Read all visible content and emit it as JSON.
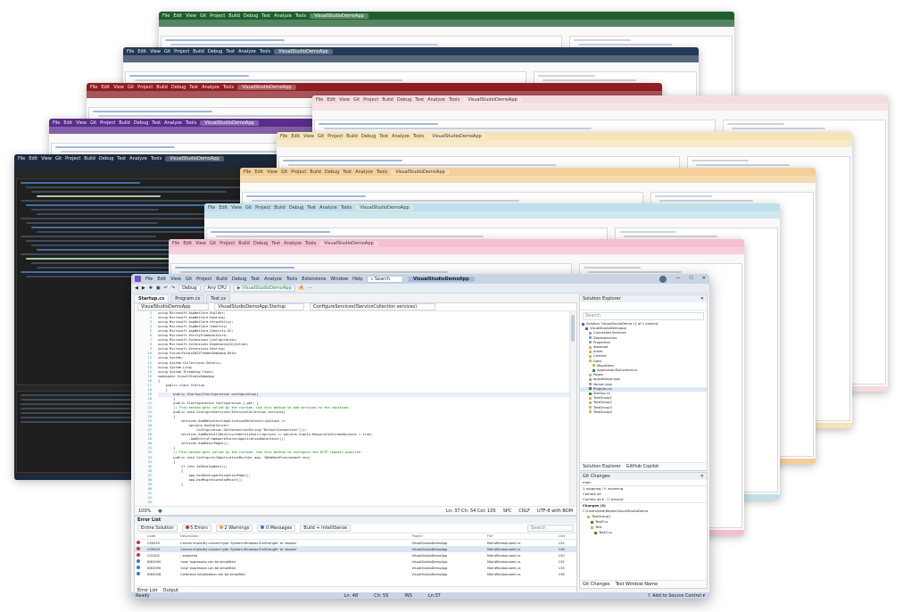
{
  "app": {
    "menu": [
      "File",
      "Edit",
      "View",
      "Git",
      "Project",
      "Build",
      "Debug",
      "Test",
      "Analyze",
      "Tools",
      "Extensions",
      "Window",
      "Help"
    ],
    "search_label": "Search",
    "window_title": "VisualStudioDemoApp"
  },
  "toolbar": {
    "config": "Debug",
    "platform": "Any CPU",
    "run_target": "▶ VisualStudioDemoApp"
  },
  "tabs": [
    {
      "label": "Startup.cs"
    },
    {
      "label": "Program.cs"
    },
    {
      "label": "Test.cs"
    }
  ],
  "editor": {
    "nav_project": "VisualStudioDemoApp",
    "nav_class": "VisualStudioDemoApp.Startup",
    "nav_member": "ConfigureServices(IServiceCollection services)",
    "zoom": "100%",
    "position": "Ln: 37  Ch: 54  Col: 105",
    "whitespace": "SPC",
    "line_ending": "CRLF",
    "encoding": "UTF-8 with BOM"
  },
  "errors": {
    "title": "Error List",
    "scope": "Entire Solution",
    "errors_count": "5 Errors",
    "warnings_count": "2 Warnings",
    "messages_count": "0 Messages",
    "build_filter": "Build + IntelliSense",
    "search_placeholder": "Search",
    "columns": [
      "Code",
      "Description",
      "Project",
      "File",
      "Line"
    ],
    "rows": [
      {
        "code": "CS0029",
        "desc": "Cannot implicitly convert type 'System.Windows.EmStrength' to 'double'",
        "project": "VisualStudioDemoApp",
        "file": "MainWindow.xaml.cs",
        "line": "122",
        "kind": "err"
      },
      {
        "code": "CS0029",
        "desc": "Cannot implicitly convert type 'System.Windows.EmStrength' to 'double'",
        "project": "VisualStudioDemoApp",
        "file": "MainWindow.xaml.cs",
        "line": "126",
        "kind": "err"
      },
      {
        "code": "CS1002",
        "desc": "; expected",
        "project": "VisualStudioDemoApp",
        "file": "MainWindow.xaml.cs",
        "line": "130",
        "kind": "err"
      },
      {
        "code": "IDE0090",
        "desc": "'new' expression can be simplified",
        "project": "VisualStudioDemoApp",
        "file": "MainWindow.xaml.cs",
        "line": "132",
        "kind": "info"
      },
      {
        "code": "IDE0090",
        "desc": "'new' expression can be simplified",
        "project": "VisualStudioDemoApp",
        "file": "MainWindow.xaml.cs",
        "line": "133",
        "kind": "info"
      },
      {
        "code": "IDE0028",
        "desc": "Collection initialization can be simplified",
        "project": "VisualStudioDemoApp",
        "file": "MainWindow.xaml.cs",
        "line": "136",
        "kind": "info"
      }
    ],
    "bottom_tabs": [
      "Error List",
      "Output"
    ]
  },
  "solution": {
    "title": "Solution Explorer",
    "search_placeholder": "Search",
    "items": [
      "Solution 'VisualStudioDemo' (1 of 1 project)",
      "VisualStudioDemoApp",
      "Connected Services",
      "Dependencies",
      "Properties",
      "wwwroot",
      "Areas",
      "Content",
      "Data",
      "Migrations",
      "ApplicationDbContext.cs",
      "Pages",
      "appsettings.json",
      "libman.json",
      "Program.cs",
      "Startup.cs",
      "TestGroup1",
      "TestGroup2",
      "TestGroup3",
      "TestGroup4"
    ],
    "selected_index": 14,
    "bottom_tabs": [
      "Solution Explorer",
      "GitHub Copilot"
    ]
  },
  "git": {
    "title": "Git Changes",
    "branch": "main",
    "sync_status": "1 outgoing / 0 incoming",
    "commit_all": "Commit all",
    "amend": "Amend",
    "changes_title": "Changes (3)",
    "path": "C:\\Users\\test\\Repos\\VisualStudioDemo",
    "files": [
      "TestGroup1",
      "TestF.cs",
      "Test",
      "Test2.cs"
    ],
    "bottom_tabs": [
      "Git Changes",
      "Test Window Name"
    ]
  },
  "status": {
    "ready": "Ready",
    "ln": "Ln: 48",
    "ch": "Ch: 55",
    "ins": "INS",
    "crlf": "Ln:37",
    "source_control": "↑ Add to Source Control ▾"
  },
  "code_lines": [
    "using Microsoft.AspNetCore.Builder;",
    "using Microsoft.AspNetCore.Hosting;",
    "using Microsoft.AspNetCore.HttpsPolicy;",
    "using Microsoft.AspNetCore.Identity;",
    "using Microsoft.AspNetCore.Identity.UI;",
    "using Microsoft.EntityFrameworkCore;",
    "using Microsoft.Extensions.Configuration;",
    "using Microsoft.Extensions.DependencyInjection;",
    "using Microsoft.Extensions.Hosting;",
    "using VisualStudio2022ThemesDemoApp.Data;",
    "using System;",
    "using System.Collections.Generic;",
    "using System.Linq;",
    "using System.Threading.Tasks;",
    "",
    "namespace VisualStudioDemoApp",
    "{",
    "    public class Startup",
    "    {",
    "        public Startup(IConfiguration configuration)",
    "        {",
    "",
    "        public IConfiguration Configuration { get; }",
    "",
    "        // This method gets called by the runtime. Use this method to add services to the container.",
    "        public void ConfigureServices(IServiceCollection services)",
    "        {",
    "            services.AddDbContext<ApplicationDbContext>(options =>",
    "                options.UseSqlServer(",
    "                    Configuration.GetConnectionString(\"DefaultConnection\")));",
    "            services.AddDefaultIdentity<IdentityUser>(options => options.SignIn.RequireConfirmedAccount = true)",
    "                .AddEntityFrameworkStores<ApplicationDbContext>();",
    "            services.AddRazorPages();",
    "        }",
    "",
    "        // This method gets called by the runtime. Use this method to configure the HTTP request pipeline.",
    "        public void Configure(IApplicationBuilder app, IWebHostEnvironment env)",
    "        {",
    "            if (env.IsDevelopment())",
    "            {",
    "                app.UseDeveloperExceptionPage();",
    "                app.UseMigrationsEndPoint();",
    "            }"
  ],
  "line_numbers": [
    "1",
    "2",
    "3",
    "4",
    "5",
    "6",
    "7",
    "8",
    "9",
    "10",
    "11",
    "12",
    "13",
    "14",
    "15",
    "16",
    "17",
    "18",
    "19",
    "20",
    "21",
    "22",
    "23",
    "24",
    "25",
    "26",
    "27",
    "28",
    "29",
    "30",
    "31",
    "32",
    "33",
    "34",
    "35",
    "36",
    "37",
    "38",
    "39",
    "40",
    "41",
    "42",
    "43"
  ],
  "back_windows": [
    {
      "color": "#1f5f2e",
      "title": "VisualStudioDemoApp",
      "dark": false
    },
    {
      "color": "#233a57",
      "title": "VisualStudioDemoApp",
      "dark": false
    },
    {
      "color": "#8f1d24",
      "title": "VisualStudioDemoApp",
      "dark": false
    },
    {
      "color": "#5a2c8c",
      "title": "VisualStudioDemoApp",
      "dark": false
    },
    {
      "color": "#1b2a3d",
      "title": "VisualStudioDemoApp",
      "dark": true
    },
    {
      "color": "#f5dcdc",
      "title": "VisualStudioDemoApp",
      "dark": false
    },
    {
      "color": "#f6e3b8",
      "title": "VisualStudioDemoApp",
      "dark": false
    },
    {
      "color": "#f4cf9a",
      "title": "VisualStudioDemoApp",
      "dark": false
    },
    {
      "color": "#bfe0ea",
      "title": "VisualStudioDemoApp",
      "dark": false
    },
    {
      "color": "#f5bfd2",
      "title": "VisualStudioDemoApp",
      "dark": false
    }
  ]
}
